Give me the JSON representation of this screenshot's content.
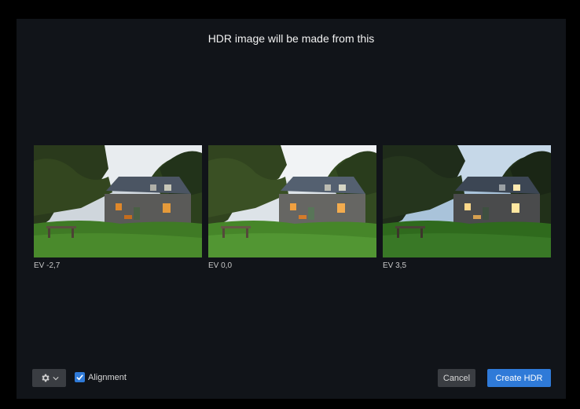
{
  "dialog": {
    "title": "HDR image will be made from this"
  },
  "images": [
    {
      "label": "EV -2,7"
    },
    {
      "label": "EV 0,0"
    },
    {
      "label": "EV 3,5"
    }
  ],
  "footer": {
    "settings_icon": "gear-icon",
    "dropdown_icon": "chevron-down-icon",
    "alignment_label": "Alignment",
    "alignment_checked": true,
    "cancel_label": "Cancel",
    "create_label": "Create HDR"
  },
  "colors": {
    "accent": "#2f7ad8",
    "dialog_bg": "#111419"
  }
}
